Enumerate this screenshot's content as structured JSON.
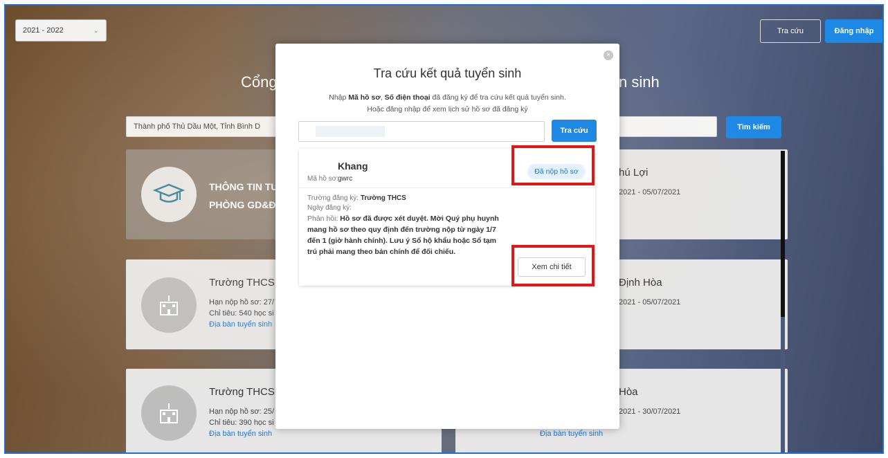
{
  "header": {
    "year_select": "2021 - 2022",
    "lookup_button": "Tra cứu",
    "login_button": "Đăng nhập"
  },
  "page": {
    "title_left": "Cổng",
    "title_right": "n sinh",
    "district_select": "Thành phố Thủ Dầu Một, Tỉnh Bình D",
    "search_button": "Tìm kiếm"
  },
  "cards": {
    "info": {
      "title1": "THÔNG TIN TU",
      "title2": "PHÒNG GD&ĐT"
    },
    "left2": {
      "title": "Trường THCS P",
      "deadline": "Hạn nộp hồ sơ: 27/",
      "quota": "Chỉ tiêu: 540 học si",
      "link": "Địa bàn tuyển sinh"
    },
    "left3": {
      "title": "Trường THCS N",
      "deadline": "Hạn nộp hồ sơ: 25/",
      "quota": "Chỉ tiêu: 390 học si",
      "link": "Địa bàn tuyển sinh"
    },
    "right1": {
      "title": "hú Lợi",
      "dates": "2021 - 05/07/2021"
    },
    "right2": {
      "title": "Định Hòa",
      "dates": "2021 - 05/07/2021"
    },
    "right3": {
      "title": "Hòa",
      "dates": "2021 - 30/07/2021",
      "link": "Địa bàn tuyển sinh"
    }
  },
  "modal": {
    "title": "Tra cứu kết quả tuyển sinh",
    "desc_prefix": "Nhập ",
    "desc_bold1": "Mã hồ sơ",
    "desc_sep": ", ",
    "desc_bold2": "Số điện thoại",
    "desc_suffix": " đã đăng ký để tra cứu kết quả tuyển sinh.",
    "desc_line2": "Hoặc đăng nhập để xem lịch sử hồ sơ đã đăng ký",
    "lookup_button": "Tra cứu",
    "close_icon": "×"
  },
  "result": {
    "name": "Khang",
    "code_label": "Mã hồ sơ:",
    "code_value": "gwrc",
    "status": "Đã nộp hồ sơ",
    "school_label": "Trường đăng ký:",
    "school_value": "Trường THCS",
    "date_label": "Ngày đăng ký:",
    "feedback_label": "Phản hồi:",
    "feedback_value": "Hồ sơ đã được xét duyệt. Mời Quý phụ huynh mang hồ sơ theo quy định đến trường nộp từ ngày 1/7 đến 1 (giờ hành chính). Lưu ý Sổ hộ khẩu hoặc Sổ tạm trú phải mang theo bản chính để đối chiếu.",
    "detail_button": "Xem chi tiết"
  },
  "colors": {
    "accent": "#1e88e5",
    "highlight": "#e31515",
    "frame_border": "#1f6fd8"
  },
  "icons": {
    "graduation": "graduation-cap-icon",
    "school": "school-building-icon",
    "chevron": "chevron-down-icon"
  }
}
